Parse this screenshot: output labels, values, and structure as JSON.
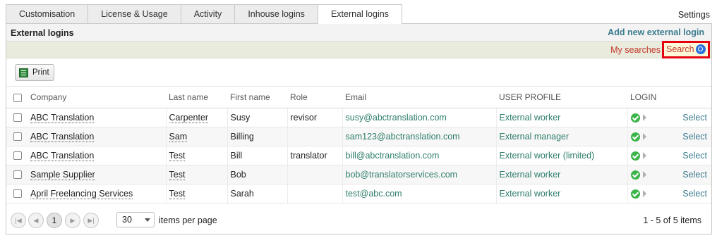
{
  "tabs": [
    {
      "label": "Customisation",
      "active": false
    },
    {
      "label": "License & Usage",
      "active": false
    },
    {
      "label": "Activity",
      "active": false
    },
    {
      "label": "Inhouse logins",
      "active": false
    },
    {
      "label": "External logins",
      "active": true
    }
  ],
  "settings_label": "Settings",
  "panel": {
    "title": "External logins",
    "add_link": "Add new external login",
    "my_searches": "My searches",
    "search": "Search"
  },
  "toolbar": {
    "print_label": "Print"
  },
  "table": {
    "headers": {
      "company": "Company",
      "last_name": "Last name",
      "first_name": "First name",
      "role": "Role",
      "email": "Email",
      "user_profile": "USER PROFILE",
      "login": "LOGIN"
    },
    "rows": [
      {
        "company": "ABC Translation",
        "last_name": "Carpenter",
        "first_name": "Susy",
        "role": "revisor",
        "email": "susy@abctranslation.com",
        "profile": "External worker",
        "action": "Select"
      },
      {
        "company": "ABC Translation",
        "last_name": "Sam",
        "first_name": "Billing",
        "role": "",
        "email": "sam123@abctranslation.com",
        "profile": "External manager",
        "action": "Select"
      },
      {
        "company": "ABC Translation",
        "last_name": "Test",
        "first_name": "Bill",
        "role": "translator",
        "email": "bill@abctranslation.com",
        "profile": "External worker (limited)",
        "action": "Select"
      },
      {
        "company": "Sample Supplier",
        "last_name": "Test",
        "first_name": "Bob",
        "role": "",
        "email": "bob@translatorservices.com",
        "profile": "External worker",
        "action": "Select"
      },
      {
        "company": "April Freelancing Services",
        "last_name": "Test",
        "first_name": "Sarah",
        "role": "",
        "email": "test@abc.com",
        "profile": "External worker",
        "action": "Select"
      }
    ]
  },
  "pager": {
    "current_page": "1",
    "page_size": "30",
    "items_per_page_label": "items per page",
    "summary": "1 - 5 of 5 items"
  },
  "colors": {
    "accent_link": "#3b7b8e",
    "email_green": "#2e7d6b",
    "search_highlight": "#e3000f",
    "my_searches_red": "#c0392b",
    "login_ok": "#3bb54a"
  }
}
